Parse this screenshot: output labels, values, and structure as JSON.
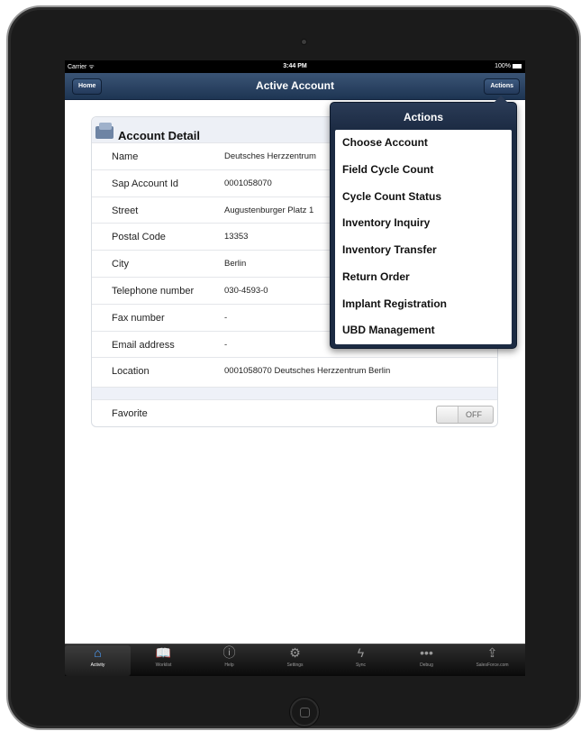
{
  "status_bar": {
    "carrier": "Carrier ᯤ",
    "time": "3:44 PM",
    "battery": "100%"
  },
  "nav_bar": {
    "title": "Active Account",
    "home_button": "Home",
    "actions_button": "Actions"
  },
  "account_detail": {
    "title": "Account Detail",
    "rows": [
      {
        "label": "Name",
        "value": "Deutsches Herzzentrum"
      },
      {
        "label": "Sap Account Id",
        "value": "0001058070"
      },
      {
        "label": "Street",
        "value": "Augustenburger Platz 1"
      },
      {
        "label": "Postal Code",
        "value": "13353"
      },
      {
        "label": "City",
        "value": "Berlin"
      },
      {
        "label": "Telephone number",
        "value": "030-4593-0"
      },
      {
        "label": "Fax number",
        "value": "-"
      },
      {
        "label": "Email address",
        "value": "-"
      },
      {
        "label": "Location",
        "value": "0001058070 Deutsches Herzzentrum Berlin"
      }
    ],
    "favorite": {
      "label": "Favorite",
      "state": "OFF"
    }
  },
  "actions_popover": {
    "title": "Actions",
    "items": [
      "Choose Account",
      "Field Cycle Count",
      "Cycle Count Status",
      "Inventory Inquiry",
      "Inventory Transfer",
      "Return Order",
      "Implant Registration",
      "UBD Management"
    ]
  },
  "tab_bar": {
    "items": [
      {
        "label": "Activity",
        "icon": "house-icon",
        "glyph": "⌂"
      },
      {
        "label": "Worklist",
        "icon": "book-icon",
        "glyph": "📖"
      },
      {
        "label": "Help",
        "icon": "info-icon",
        "glyph": "ⓘ"
      },
      {
        "label": "Settings",
        "icon": "gear-icon",
        "glyph": "⚙"
      },
      {
        "label": "Sync",
        "icon": "lightning-icon",
        "glyph": "ϟ"
      },
      {
        "label": "Debug",
        "icon": "dots-icon",
        "glyph": "•••"
      },
      {
        "label": "SalesForce.com",
        "icon": "share-icon",
        "glyph": "⇪"
      }
    ]
  }
}
